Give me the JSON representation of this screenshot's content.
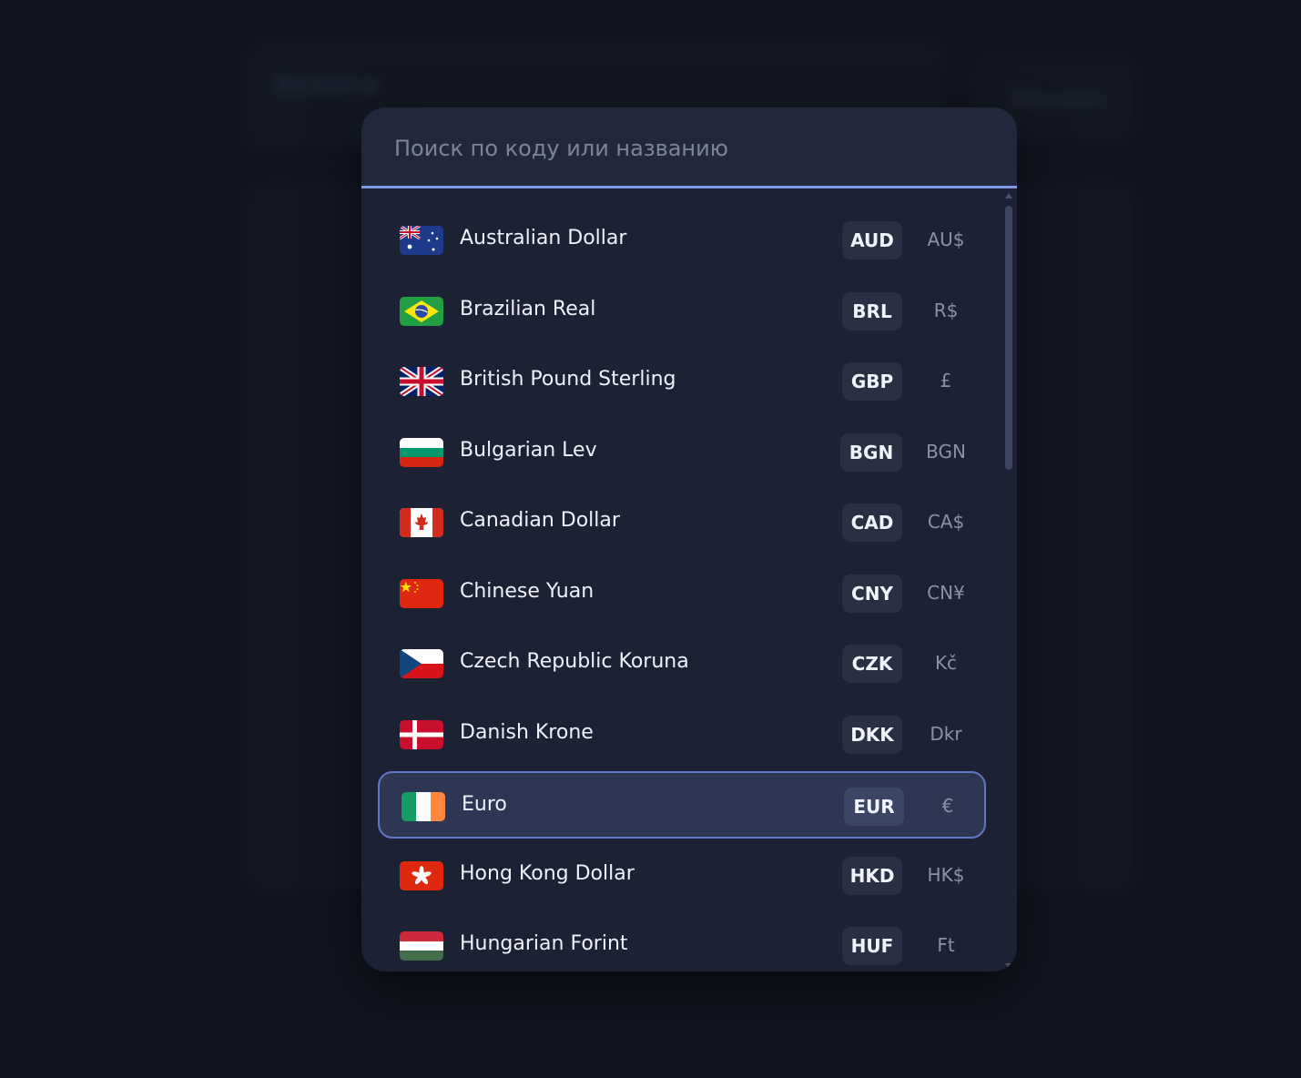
{
  "background": {
    "title": "Валюта",
    "side_button": "Обновить"
  },
  "search": {
    "placeholder": "Поиск по коду или названию"
  },
  "currencies": [
    {
      "name": "Australian Dollar",
      "code": "AUD",
      "symbol": "AU$",
      "flag": "australia-flag-icon"
    },
    {
      "name": "Brazilian Real",
      "code": "BRL",
      "symbol": "R$",
      "flag": "brazil-flag-icon"
    },
    {
      "name": "British Pound Sterling",
      "code": "GBP",
      "symbol": "£",
      "flag": "uk-flag-icon"
    },
    {
      "name": "Bulgarian Lev",
      "code": "BGN",
      "symbol": "BGN",
      "flag": "bulgaria-flag-icon"
    },
    {
      "name": "Canadian Dollar",
      "code": "CAD",
      "symbol": "CA$",
      "flag": "canada-flag-icon"
    },
    {
      "name": "Chinese Yuan",
      "code": "CNY",
      "symbol": "CN¥",
      "flag": "china-flag-icon"
    },
    {
      "name": "Czech Republic Koruna",
      "code": "CZK",
      "symbol": "Kč",
      "flag": "czech-flag-icon"
    },
    {
      "name": "Danish Krone",
      "code": "DKK",
      "symbol": "Dkr",
      "flag": "denmark-flag-icon"
    },
    {
      "name": "Euro",
      "code": "EUR",
      "symbol": "€",
      "flag": "ireland-flag-icon",
      "selected": true
    },
    {
      "name": "Hong Kong Dollar",
      "code": "HKD",
      "symbol": "HK$",
      "flag": "hong-kong-flag-icon"
    },
    {
      "name": "Hungarian Forint",
      "code": "HUF",
      "symbol": "Ft",
      "flag": "hungary-flag-icon"
    }
  ],
  "colors": {
    "accent": "#7e98e6",
    "selected_border": "#5f77c6",
    "modal_bg": "#1c2133"
  }
}
